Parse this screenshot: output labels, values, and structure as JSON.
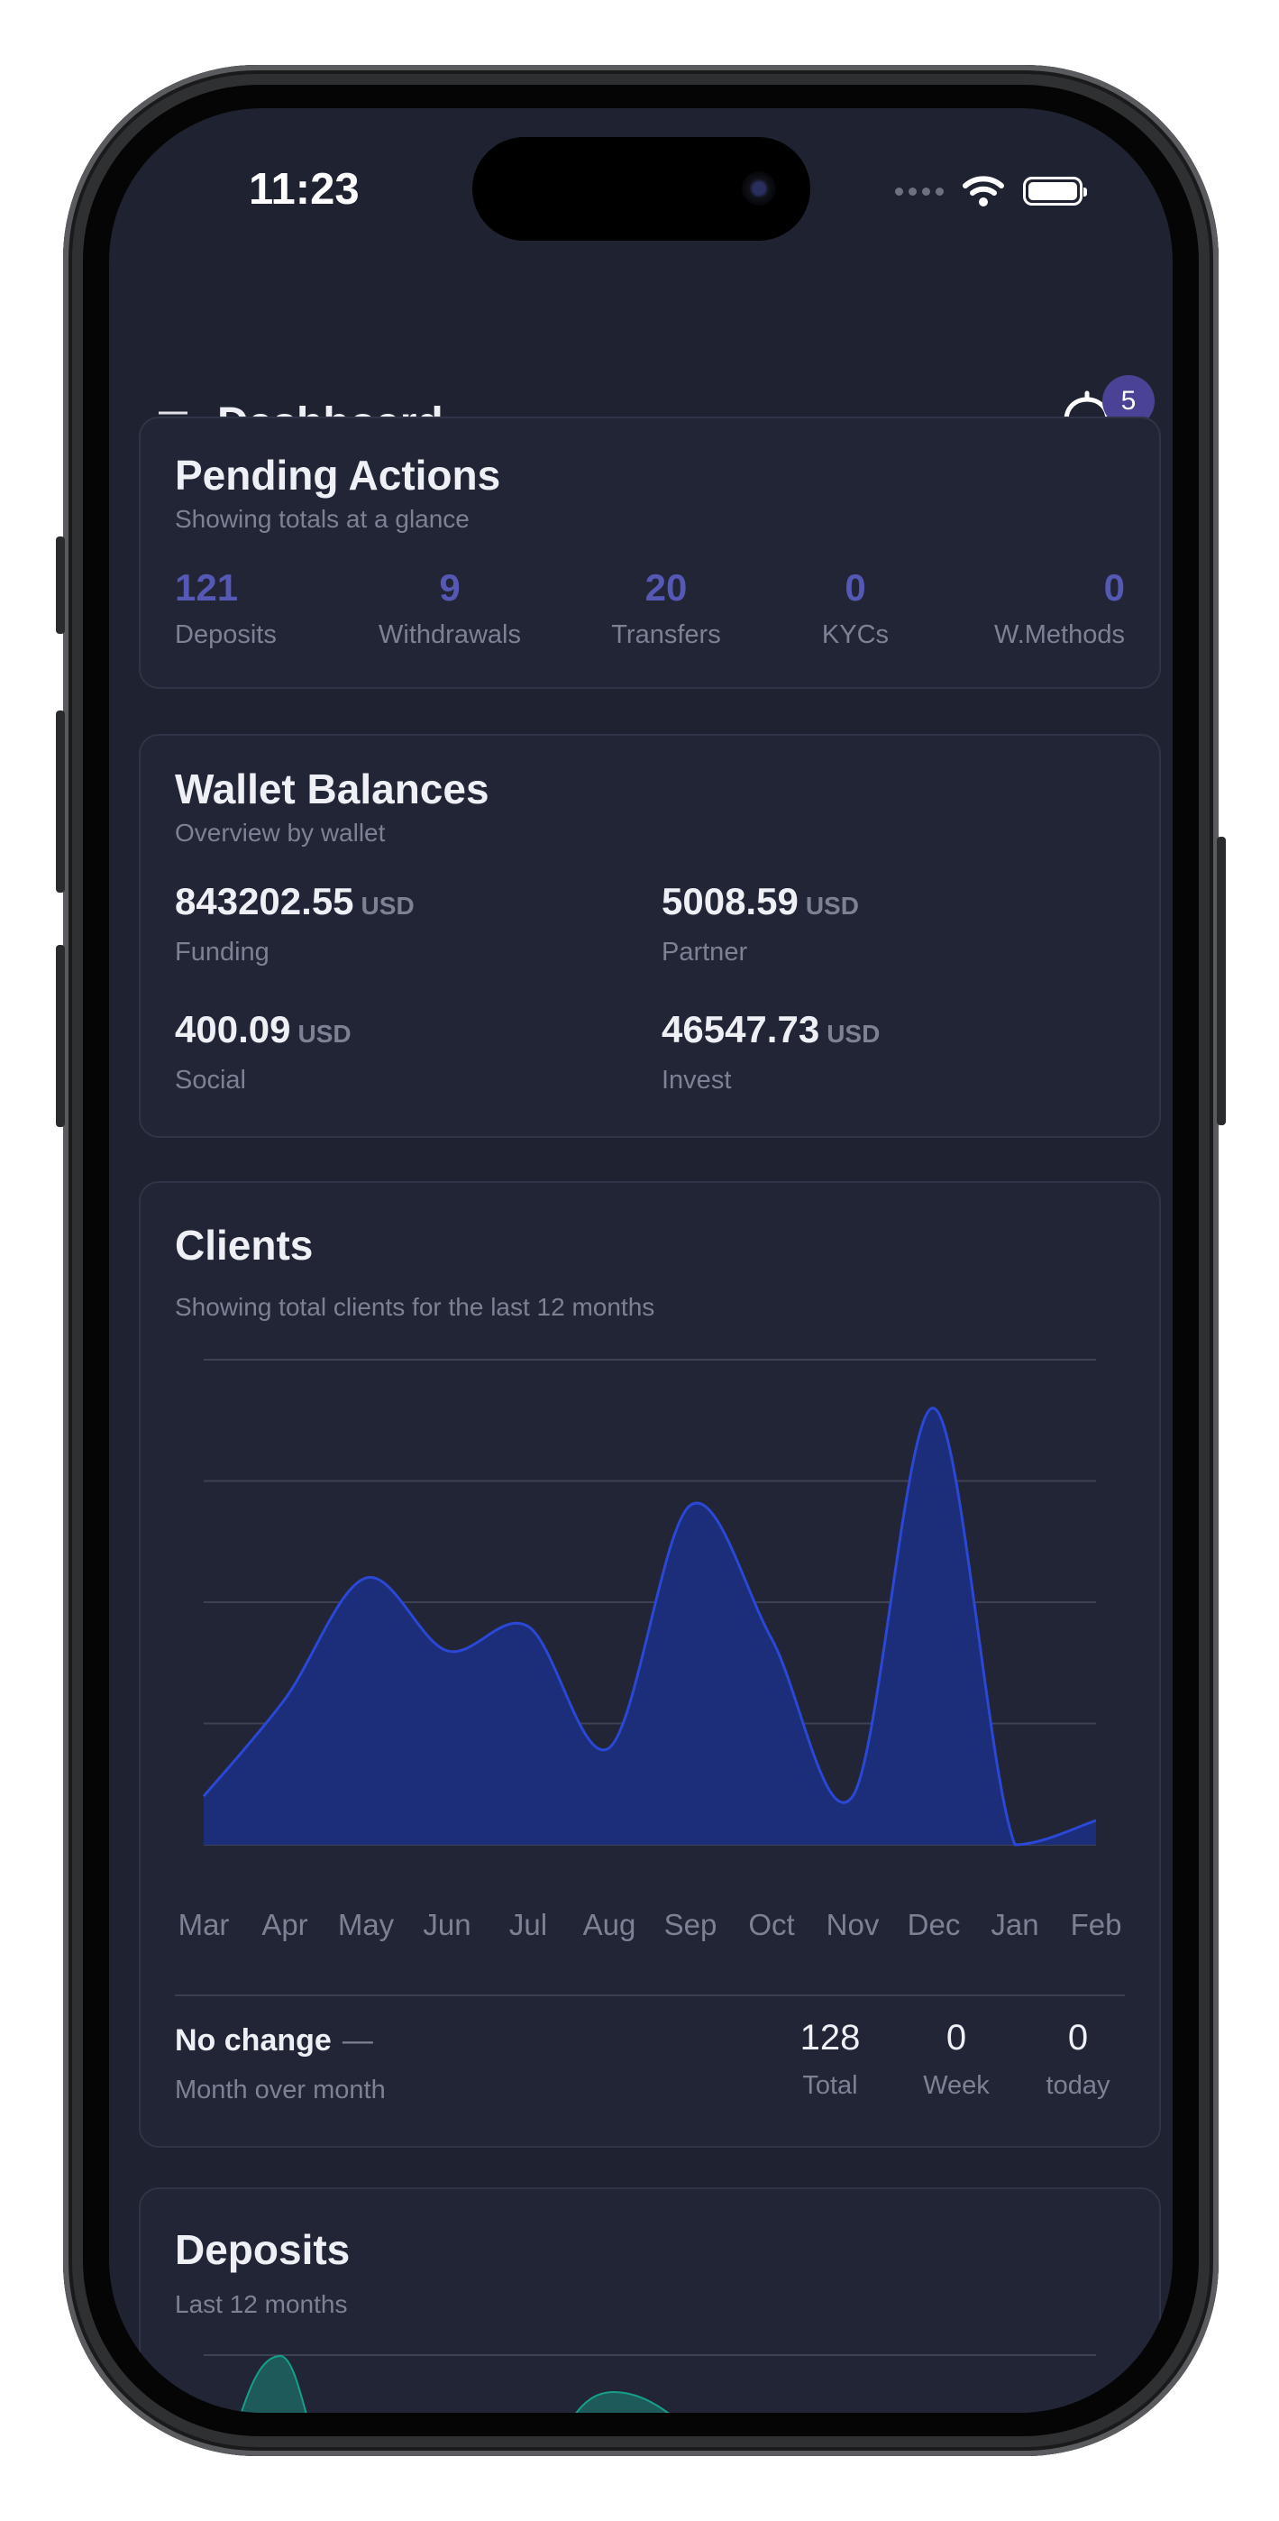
{
  "status_bar": {
    "time": "11:23"
  },
  "header": {
    "title": "Dashboard",
    "notification_count": "5"
  },
  "pending": {
    "title": "Pending Actions",
    "subtitle": "Showing totals at a glance",
    "stats": [
      {
        "value": "121",
        "label": "Deposits"
      },
      {
        "value": "9",
        "label": "Withdrawals"
      },
      {
        "value": "20",
        "label": "Transfers"
      },
      {
        "value": "0",
        "label": "KYCs"
      },
      {
        "value": "0",
        "label": "W.Methods"
      }
    ]
  },
  "wallets": {
    "title": "Wallet Balances",
    "subtitle": "Overview by wallet",
    "currency": "USD",
    "items": [
      {
        "amount": "843202.55",
        "label": "Funding"
      },
      {
        "amount": "5008.59",
        "label": "Partner"
      },
      {
        "amount": "400.09",
        "label": "Social"
      },
      {
        "amount": "46547.73",
        "label": "Invest"
      }
    ]
  },
  "clients": {
    "title": "Clients",
    "subtitle": "Showing total clients for the last 12 months",
    "change_label": "No change",
    "change_dash": "—",
    "change_caption": "Month over month",
    "totals": [
      {
        "value": "128",
        "label": "Total"
      },
      {
        "value": "0",
        "label": "Week"
      },
      {
        "value": "0",
        "label": "today"
      }
    ]
  },
  "deposits": {
    "title": "Deposits",
    "subtitle": "Last 12 months"
  },
  "chart_data": [
    {
      "type": "area",
      "categories": [
        "Mar",
        "Apr",
        "May",
        "Jun",
        "Jul",
        "Aug",
        "Sep",
        "Oct",
        "Nov",
        "Dec",
        "Jan",
        "Feb"
      ],
      "values": [
        4,
        12,
        22,
        16,
        18,
        8,
        28,
        17,
        4,
        36,
        0,
        2
      ],
      "ylim": [
        0,
        40
      ],
      "grid": true,
      "color": "#2b47d6"
    }
  ],
  "colors": {
    "accent": "#5658b5",
    "deposits_series": "#12a08a"
  }
}
